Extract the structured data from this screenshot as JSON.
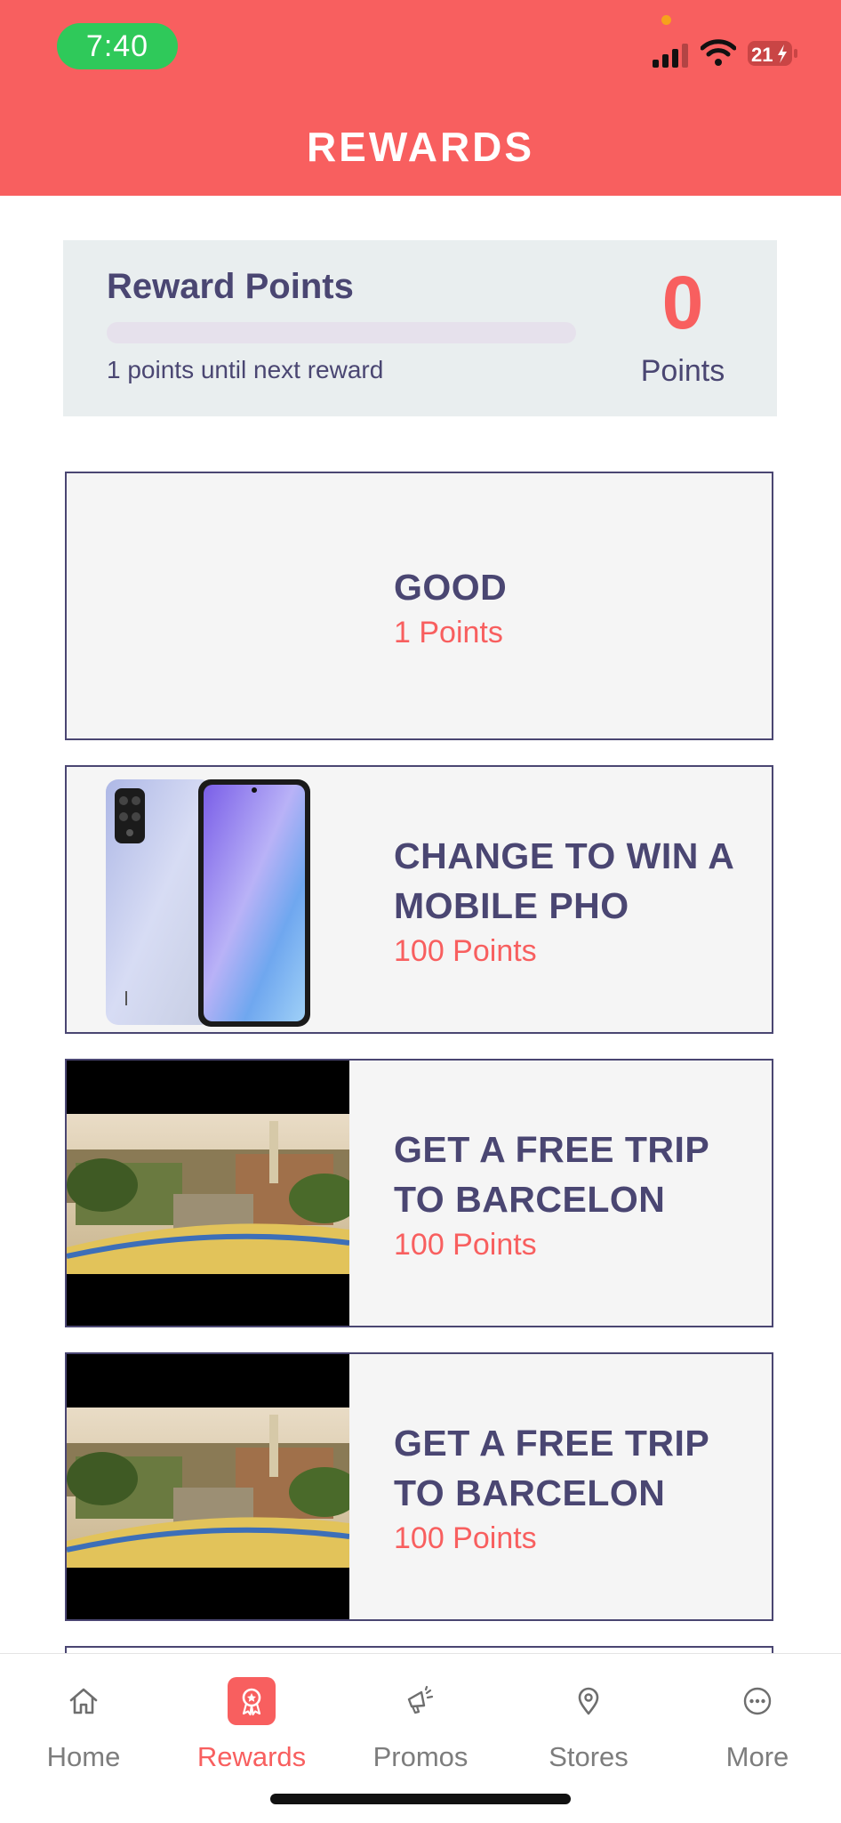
{
  "status_bar": {
    "time": "7:40",
    "battery": "21"
  },
  "header": {
    "title": "REWARDS"
  },
  "points_card": {
    "title": "Reward Points",
    "progress_fraction": 0,
    "until_text": "1 points until next reward",
    "points_value": "0",
    "points_label": "Points"
  },
  "rewards": [
    {
      "name": "GOOD",
      "cost": "1 Points",
      "image": "none"
    },
    {
      "name": "CHANGE  TO WIN A MOBILE PHO",
      "cost": "100 Points",
      "image": "phone-image"
    },
    {
      "name": "GET A FREE TRIP TO BARCELON",
      "cost": "100 Points",
      "image": "barcelona-park-image"
    },
    {
      "name": "GET A FREE TRIP TO BARCELON",
      "cost": "100 Points",
      "image": "barcelona-park-image"
    }
  ],
  "tabs": [
    {
      "label": "Home",
      "icon": "home-icon"
    },
    {
      "label": "Rewards",
      "icon": "rewards-badge-icon",
      "active": true
    },
    {
      "label": "Promos",
      "icon": "megaphone-icon"
    },
    {
      "label": "Stores",
      "icon": "location-pin-icon"
    },
    {
      "label": "More",
      "icon": "more-dots-icon"
    }
  ],
  "colors": {
    "accent": "#f85f5f",
    "text": "#4a4672",
    "card_bg": "#e9eeef",
    "status_green": "#2fc95a"
  }
}
